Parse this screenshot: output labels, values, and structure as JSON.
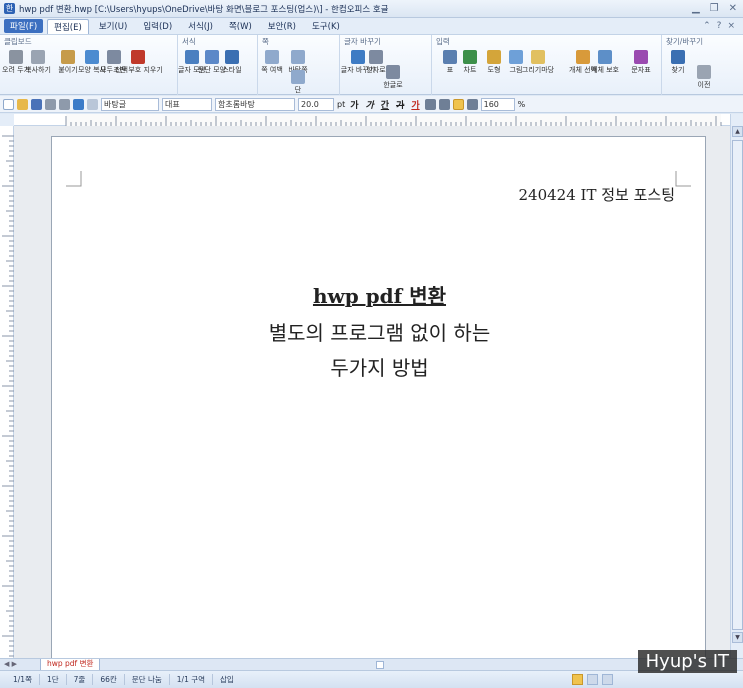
{
  "window": {
    "title": "hwp pdf 변환.hwp [C:\\Users\\hyups\\OneDrive\\바탕 화면\\블로그 포스팅(업스)\\] - 한컴오피스 호글"
  },
  "menu": {
    "items": [
      "파일(F)",
      "편집(E)",
      "보기(U)",
      "입력(D)",
      "서식(J)",
      "쪽(W)",
      "보안(R)",
      "도구(K)"
    ]
  },
  "ribbon": {
    "groups": [
      "클립보드",
      "서식",
      "쪽",
      "글자 바꾸기",
      "입력",
      "찾기/바꾸기"
    ],
    "buttons": [
      {
        "label": "오려 두기",
        "icon": "scissors-icon"
      },
      {
        "label": "복사하기",
        "icon": "copy-icon"
      },
      {
        "label": "붙이기",
        "icon": "paste-icon"
      },
      {
        "label": "모양 복사",
        "icon": "format-painter-icon"
      },
      {
        "label": "모두 선택",
        "icon": "select-all-icon"
      },
      {
        "label": "조판 부호 지우기",
        "icon": "eraser-icon"
      },
      {
        "label": "글자 모양",
        "icon": "char-shape-icon"
      },
      {
        "label": "문단 모양",
        "icon": "para-shape-icon"
      },
      {
        "label": "스타일",
        "icon": "style-icon"
      },
      {
        "label": "쪽 여백",
        "icon": "margin-icon"
      },
      {
        "label": "바탕쪽",
        "icon": "master-page-icon"
      },
      {
        "label": "단",
        "icon": "column-icon"
      },
      {
        "label": "한자로",
        "icon": "hanja-icon"
      },
      {
        "label": "한글로",
        "icon": "hangul-icon"
      },
      {
        "label": "글자 바꾸기",
        "icon": "char-convert-icon"
      },
      {
        "label": "표",
        "icon": "table-icon"
      },
      {
        "label": "차트",
        "icon": "chart-icon"
      },
      {
        "label": "도형",
        "icon": "shape-icon"
      },
      {
        "label": "그림",
        "icon": "picture-icon"
      },
      {
        "label": "그리기마당",
        "icon": "clipart-icon"
      },
      {
        "label": "개체 선택",
        "icon": "object-select-icon"
      },
      {
        "label": "개체 보호",
        "icon": "object-protect-icon"
      },
      {
        "label": "문자표",
        "icon": "symbol-icon"
      },
      {
        "label": "찾기",
        "icon": "find-icon"
      },
      {
        "label": "이전",
        "icon": "prev-icon"
      }
    ]
  },
  "formatbar": {
    "style": "바탕글",
    "lang": "대표",
    "font": "함초롬바탕",
    "size": "20.0",
    "unit": "pt",
    "bold": "가",
    "italic": "가",
    "underline": "간",
    "strike": "가",
    "color": "가",
    "line_spacing": "160",
    "percent": "%"
  },
  "document": {
    "header_text": "240424 IT 정보 포스팅",
    "title": "hwp pdf 변환",
    "line2": "별도의 프로그램 없이 하는",
    "line3": "두가지 방법"
  },
  "tab": {
    "label": "hwp pdf 변환"
  },
  "status": {
    "items": [
      "1/1쪽",
      "1단",
      "7줄",
      "66칸",
      "문단 나눔",
      "1/1 구역",
      "삽입"
    ]
  },
  "watermark": "Hyup's IT"
}
